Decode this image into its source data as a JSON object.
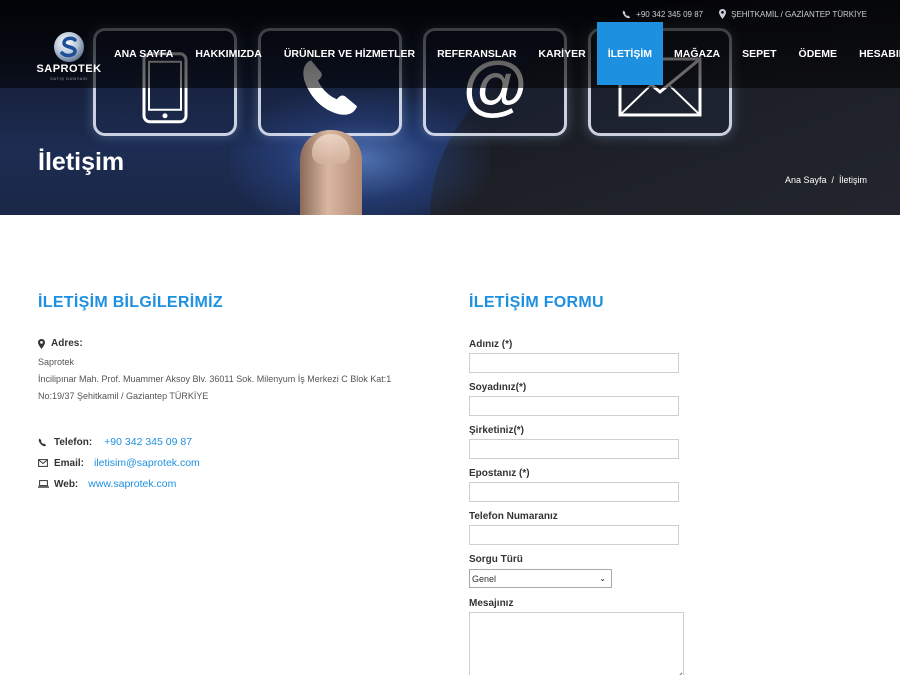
{
  "topbar": {
    "phone": "+90 342 345 09 87",
    "location": "ŞEHİTKAMİL / GAZİANTEP TÜRKİYE"
  },
  "logo": {
    "name": "SAPROTEK",
    "tagline": "SATIŞ DÜNYASI"
  },
  "nav": {
    "items": [
      {
        "label": "ANA SAYFA"
      },
      {
        "label": "HAKKIMIZDA"
      },
      {
        "label": "ÜRÜNLER VE HİZMETLER"
      },
      {
        "label": "REFERANSLAR"
      },
      {
        "label": "KARİYER"
      },
      {
        "label": "İLETİŞİM",
        "active": true
      },
      {
        "label": "MAĞAZA"
      },
      {
        "label": "SEPET"
      },
      {
        "label": "ÖDEME"
      },
      {
        "label": "HESABIM"
      }
    ]
  },
  "page": {
    "title": "İletişim",
    "breadcrumb": {
      "home": "Ana Sayfa",
      "separator": "/",
      "current": "İletişim"
    }
  },
  "info": {
    "heading": "İLETİŞİM BİLGİLERİMİZ",
    "address_label": "Adres:",
    "address_lines": [
      "Saprotek",
      "İncilipınar Mah. Prof. Muammer Aksoy Blv. 36011 Sok. Milenyum İş Merkezi C Blok Kat:1",
      "No:19/37 Şehitkamil / Gaziantep TÜRKİYE"
    ],
    "phone_label": "Telefon:",
    "phone": "+90 342 345 09 87",
    "email_label": "Email:",
    "email": "iletisim@saprotek.com",
    "web_label": "Web:",
    "web": "www.saprotek.com"
  },
  "form": {
    "heading": "İLETİŞİM FORMU",
    "name_label": "Adınız (*)",
    "surname_label": "Soyadınız(*)",
    "company_label": "Şirketiniz(*)",
    "email_label": "Epostanız (*)",
    "phone_label": "Telefon Numaranız",
    "query_label": "Sorgu Türü",
    "query_selected": "Genel",
    "message_label": "Mesajınız"
  },
  "colors": {
    "accent": "#1e90e0",
    "nav_active": "#1e90e0"
  }
}
